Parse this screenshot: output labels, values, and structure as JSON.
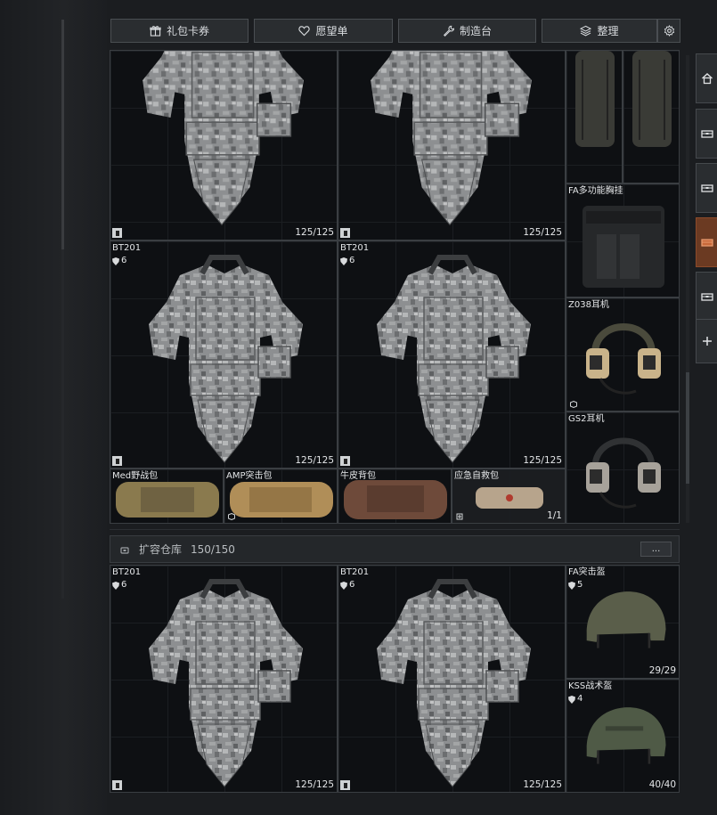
{
  "toolbar": {
    "gift_label": "礼包卡券",
    "wish_label": "愿望单",
    "craft_label": "制造台",
    "sort_label": "整理"
  },
  "main_storage": {
    "vest_top_1": {
      "durability": "125/125"
    },
    "vest_top_2": {
      "durability": "125/125"
    },
    "vest_a": {
      "name": "BT201",
      "level": "6",
      "durability": "125/125"
    },
    "vest_b": {
      "name": "BT201",
      "level": "6",
      "durability": "125/125"
    },
    "chest_rig": {
      "name": "FA多功能胸挂"
    },
    "headset_1": {
      "name": "Z038耳机"
    },
    "headset_2": {
      "name": "GS2耳机"
    },
    "bag_1": {
      "name": "Med野战包"
    },
    "bag_2": {
      "name": "AMP突击包"
    },
    "bag_3": {
      "name": "牛皮背包"
    },
    "medkit": {
      "name": "应急自救包",
      "count": "1/1"
    }
  },
  "expansion": {
    "title": "扩容仓库",
    "capacity": "150/150",
    "more_label": "...",
    "vest_c": {
      "name": "BT201",
      "level": "6",
      "durability": "125/125"
    },
    "vest_d": {
      "name": "BT201",
      "level": "6",
      "durability": "125/125"
    },
    "helmet_1": {
      "name": "FA突击盔",
      "level": "5",
      "durability": "29/29"
    },
    "helmet_2": {
      "name": "KSS战术盔",
      "level": "4",
      "durability": "40/40"
    }
  },
  "colors": {
    "accent_active_tab": "#6b3a22",
    "cell_bg": "#0e1013",
    "cell_border": "#3a3e42"
  }
}
